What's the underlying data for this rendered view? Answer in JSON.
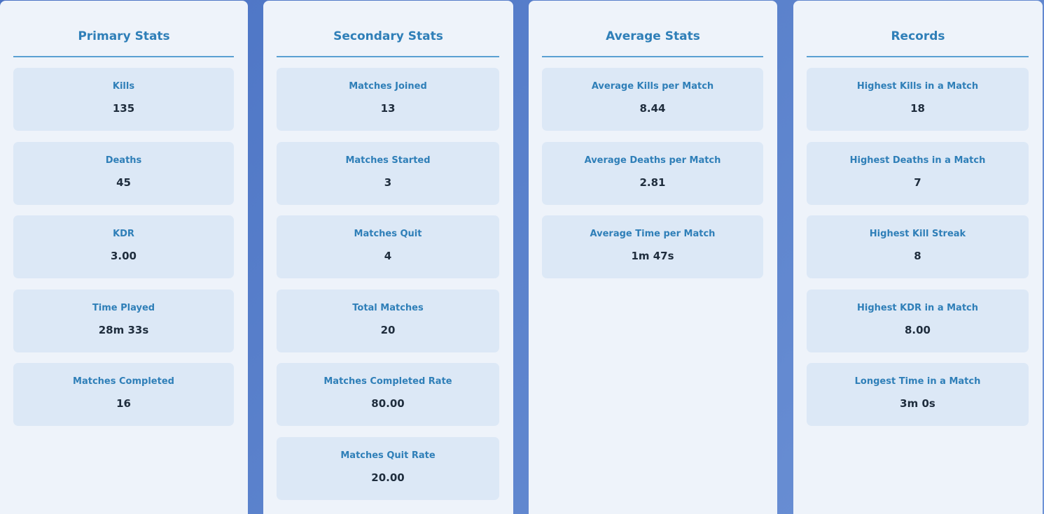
{
  "panels": [
    {
      "title": "Primary Stats",
      "stats": [
        {
          "label": "Kills",
          "value": "135"
        },
        {
          "label": "Deaths",
          "value": "45"
        },
        {
          "label": "KDR",
          "value": "3.00"
        },
        {
          "label": "Time Played",
          "value": "28m 33s"
        },
        {
          "label": "Matches Completed",
          "value": "16"
        }
      ]
    },
    {
      "title": "Secondary Stats",
      "stats": [
        {
          "label": "Matches Joined",
          "value": "13"
        },
        {
          "label": "Matches Started",
          "value": "3"
        },
        {
          "label": "Matches Quit",
          "value": "4"
        },
        {
          "label": "Total Matches",
          "value": "20"
        },
        {
          "label": "Matches Completed Rate",
          "value": "80.00"
        },
        {
          "label": "Matches Quit Rate",
          "value": "20.00"
        }
      ]
    },
    {
      "title": "Average Stats",
      "stats": [
        {
          "label": "Average Kills per Match",
          "value": "8.44"
        },
        {
          "label": "Average Deaths per Match",
          "value": "2.81"
        },
        {
          "label": "Average Time per Match",
          "value": "1m 47s"
        }
      ]
    },
    {
      "title": "Records",
      "stats": [
        {
          "label": "Highest Kills in a Match",
          "value": "18"
        },
        {
          "label": "Highest Deaths in a Match",
          "value": "7"
        },
        {
          "label": "Highest Kill Streak",
          "value": "8"
        },
        {
          "label": "Highest KDR in a Match",
          "value": "8.00"
        },
        {
          "label": "Longest Time in a Match",
          "value": "3m 0s"
        }
      ]
    }
  ],
  "colors": {
    "background": "#5b82cc",
    "panel": "#eef3fa",
    "card": "#dce8f6",
    "accent": "#2f7fb8",
    "value_text": "#1f2d3d"
  }
}
